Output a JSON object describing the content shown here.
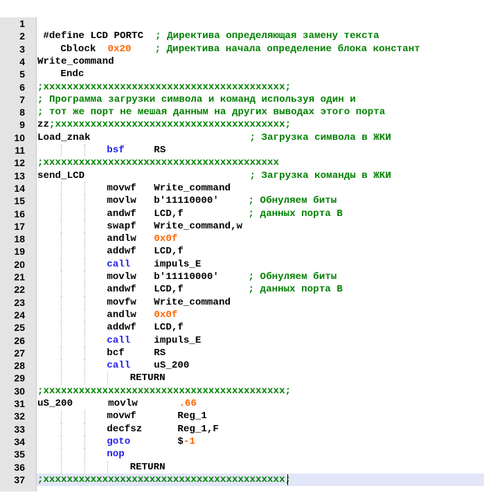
{
  "editor": {
    "current_line": 37,
    "lines": [
      {
        "n": "1",
        "col": 0,
        "tokens": []
      },
      {
        "n": "2",
        "col": 1,
        "tokens": [
          {
            "t": "#define LCD PORTC  ",
            "k": "text"
          },
          {
            "t": "; Директива определяющая замену текста",
            "k": "comment"
          }
        ]
      },
      {
        "n": "3",
        "col": 4,
        "tokens": [
          {
            "t": "Cblock  ",
            "k": "text"
          },
          {
            "t": "0x20",
            "k": "number"
          },
          {
            "t": "    ",
            "k": "text"
          },
          {
            "t": "; Директива начала определение блока констант",
            "k": "comment"
          }
        ]
      },
      {
        "n": "4",
        "col": 0,
        "tokens": [
          {
            "t": "Write_command",
            "k": "text"
          }
        ]
      },
      {
        "n": "5",
        "col": 4,
        "tokens": [
          {
            "t": "Endc",
            "k": "text"
          }
        ]
      },
      {
        "n": "6",
        "col": 0,
        "tokens": [
          {
            "t": ";xxxxxxxxxxxxxxxxxxxxxxxxxxxxxxxxxxxxxxxxx;",
            "k": "comment"
          }
        ]
      },
      {
        "n": "7",
        "col": 0,
        "tokens": [
          {
            "t": "; Программа загрузки символа и команд используя один и",
            "k": "comment"
          }
        ]
      },
      {
        "n": "8",
        "col": 0,
        "tokens": [
          {
            "t": "; тот же порт не мешая данным на других выводах этого порта",
            "k": "comment"
          }
        ]
      },
      {
        "n": "9",
        "col": 0,
        "tokens": [
          {
            "t": "zz",
            "k": "text"
          },
          {
            "t": ";xxxxxxxxxxxxxxxxxxxxxxxxxxxxxxxxxxxxxxx;",
            "k": "comment"
          }
        ]
      },
      {
        "n": "10",
        "col": 0,
        "tokens": [
          {
            "t": "Load_znak                           ",
            "k": "text"
          },
          {
            "t": "; Загрузка символа в ЖКИ",
            "k": "comment"
          }
        ]
      },
      {
        "n": "11",
        "col": 12,
        "tokens": [
          {
            "t": "bsf",
            "k": "instr-blue"
          },
          {
            "t": "     RS",
            "k": "text"
          }
        ]
      },
      {
        "n": "12",
        "col": 0,
        "tokens": [
          {
            "t": ";xxxxxxxxxxxxxxxxxxxxxxxxxxxxxxxxxxxxxxxx",
            "k": "comment"
          }
        ]
      },
      {
        "n": "13",
        "col": 0,
        "tokens": [
          {
            "t": "send_LCD                            ",
            "k": "text"
          },
          {
            "t": "; Загрузка команды в ЖКИ",
            "k": "comment"
          }
        ]
      },
      {
        "n": "14",
        "col": 12,
        "tokens": [
          {
            "t": "movwf   Write_command",
            "k": "instr-black"
          }
        ]
      },
      {
        "n": "15",
        "col": 12,
        "tokens": [
          {
            "t": "movlw   b'11110000'     ",
            "k": "instr-black"
          },
          {
            "t": "; Обнуляем биты",
            "k": "comment"
          }
        ]
      },
      {
        "n": "16",
        "col": 12,
        "tokens": [
          {
            "t": "andwf   LCD,f           ",
            "k": "instr-black"
          },
          {
            "t": "; данных порта B",
            "k": "comment"
          }
        ]
      },
      {
        "n": "17",
        "col": 12,
        "tokens": [
          {
            "t": "swapf   Write_command,w",
            "k": "instr-black"
          }
        ]
      },
      {
        "n": "18",
        "col": 12,
        "tokens": [
          {
            "t": "andlw   ",
            "k": "instr-black"
          },
          {
            "t": "0x0f",
            "k": "number"
          }
        ]
      },
      {
        "n": "19",
        "col": 12,
        "tokens": [
          {
            "t": "addwf   LCD,f",
            "k": "instr-black"
          }
        ]
      },
      {
        "n": "20",
        "col": 12,
        "tokens": [
          {
            "t": "call",
            "k": "instr-blue"
          },
          {
            "t": "    impuls_E",
            "k": "text"
          }
        ]
      },
      {
        "n": "21",
        "col": 12,
        "tokens": [
          {
            "t": "movlw   b'11110000'     ",
            "k": "instr-black"
          },
          {
            "t": "; Обнуляем биты",
            "k": "comment"
          }
        ]
      },
      {
        "n": "22",
        "col": 12,
        "tokens": [
          {
            "t": "andwf   LCD,f           ",
            "k": "instr-black"
          },
          {
            "t": "; данных порта B",
            "k": "comment"
          }
        ]
      },
      {
        "n": "23",
        "col": 12,
        "tokens": [
          {
            "t": "movfw   Write_command",
            "k": "instr-black"
          }
        ]
      },
      {
        "n": "24",
        "col": 12,
        "tokens": [
          {
            "t": "andlw   ",
            "k": "instr-black"
          },
          {
            "t": "0x0f",
            "k": "number"
          }
        ]
      },
      {
        "n": "25",
        "col": 12,
        "tokens": [
          {
            "t": "addwf   LCD,f",
            "k": "instr-black"
          }
        ]
      },
      {
        "n": "26",
        "col": 12,
        "tokens": [
          {
            "t": "call",
            "k": "instr-blue"
          },
          {
            "t": "    impuls_E",
            "k": "text"
          }
        ]
      },
      {
        "n": "27",
        "col": 12,
        "tokens": [
          {
            "t": "bcf     RS",
            "k": "instr-black"
          }
        ]
      },
      {
        "n": "28",
        "col": 12,
        "tokens": [
          {
            "t": "call",
            "k": "instr-blue"
          },
          {
            "t": "    uS_200",
            "k": "text"
          }
        ]
      },
      {
        "n": "29",
        "col": 16,
        "tokens": [
          {
            "t": "RETURN",
            "k": "text"
          }
        ]
      },
      {
        "n": "30",
        "col": 0,
        "tokens": [
          {
            "t": ";xxxxxxxxxxxxxxxxxxxxxxxxxxxxxxxxxxxxxxxxx;",
            "k": "comment"
          }
        ]
      },
      {
        "n": "31",
        "col": 0,
        "tokens": [
          {
            "t": "uS_200      movlw       ",
            "k": "text"
          },
          {
            "t": ".66",
            "k": "number"
          }
        ]
      },
      {
        "n": "32",
        "col": 12,
        "tokens": [
          {
            "t": "movwf       Reg_1",
            "k": "instr-black"
          }
        ]
      },
      {
        "n": "33",
        "col": 12,
        "tokens": [
          {
            "t": "decfsz      Reg_1,F",
            "k": "instr-black"
          }
        ]
      },
      {
        "n": "34",
        "col": 12,
        "tokens": [
          {
            "t": "goto",
            "k": "instr-blue"
          },
          {
            "t": "        $",
            "k": "text"
          },
          {
            "t": "-1",
            "k": "number"
          }
        ]
      },
      {
        "n": "35",
        "col": 12,
        "tokens": [
          {
            "t": "nop",
            "k": "instr-blue"
          }
        ]
      },
      {
        "n": "36",
        "col": 16,
        "tokens": [
          {
            "t": "RETURN",
            "k": "text"
          }
        ]
      },
      {
        "n": "37",
        "col": 0,
        "tokens": [
          {
            "t": ";xxxxxxxxxxxxxxxxxxxxxxxxxxxxxxxxxxxxxxxxx;",
            "k": "comment"
          }
        ]
      }
    ]
  }
}
